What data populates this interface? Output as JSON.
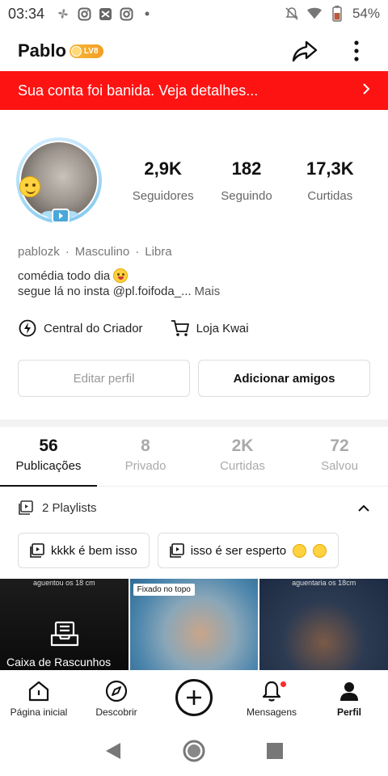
{
  "status_bar": {
    "time": "03:34",
    "battery": "54%"
  },
  "header": {
    "name": "Pablo",
    "level": "LV8"
  },
  "ban_banner": {
    "text": "Sua conta foi banida. Veja detalhes..."
  },
  "profile": {
    "stats": [
      {
        "value": "2,9K",
        "label": "Seguidores"
      },
      {
        "value": "182",
        "label": "Seguindo"
      },
      {
        "value": "17,3K",
        "label": "Curtidas"
      }
    ],
    "username": "pablozk",
    "gender": "Masculino",
    "sign": "Libra",
    "bio_line1": "comédia todo dia",
    "bio_line2": "segue lá no insta @pl.foifoda_...",
    "bio_more": "Mais"
  },
  "tools": {
    "creator_center": "Central do Criador",
    "shop": "Loja Kwai"
  },
  "actions": {
    "edit_profile": "Editar perfil",
    "add_friends": "Adicionar amigos"
  },
  "content_tabs": [
    {
      "count": "56",
      "label": "Publicações"
    },
    {
      "count": "8",
      "label": "Privado"
    },
    {
      "count": "2K",
      "label": "Curtidas"
    },
    {
      "count": "72",
      "label": "Salvou"
    }
  ],
  "playlists": {
    "title": "2 Playlists",
    "items": [
      {
        "label": "kkkk é bem isso"
      },
      {
        "label": "isso é ser esperto"
      }
    ]
  },
  "thumbnails": {
    "caption1": "aguentou os 18 cm",
    "drafts_label": "Caixa de Rascunhos",
    "pinned_label": "Fixado no topo",
    "caption3": "aguentaria os 18cm"
  },
  "bottom_nav": [
    {
      "label": "Página inicial"
    },
    {
      "label": "Descobrir"
    },
    {
      "label": ""
    },
    {
      "label": "Mensagens"
    },
    {
      "label": "Perfil"
    }
  ],
  "colors": {
    "ban_red": "#fe1313",
    "level_gold": "#f6b73c"
  }
}
